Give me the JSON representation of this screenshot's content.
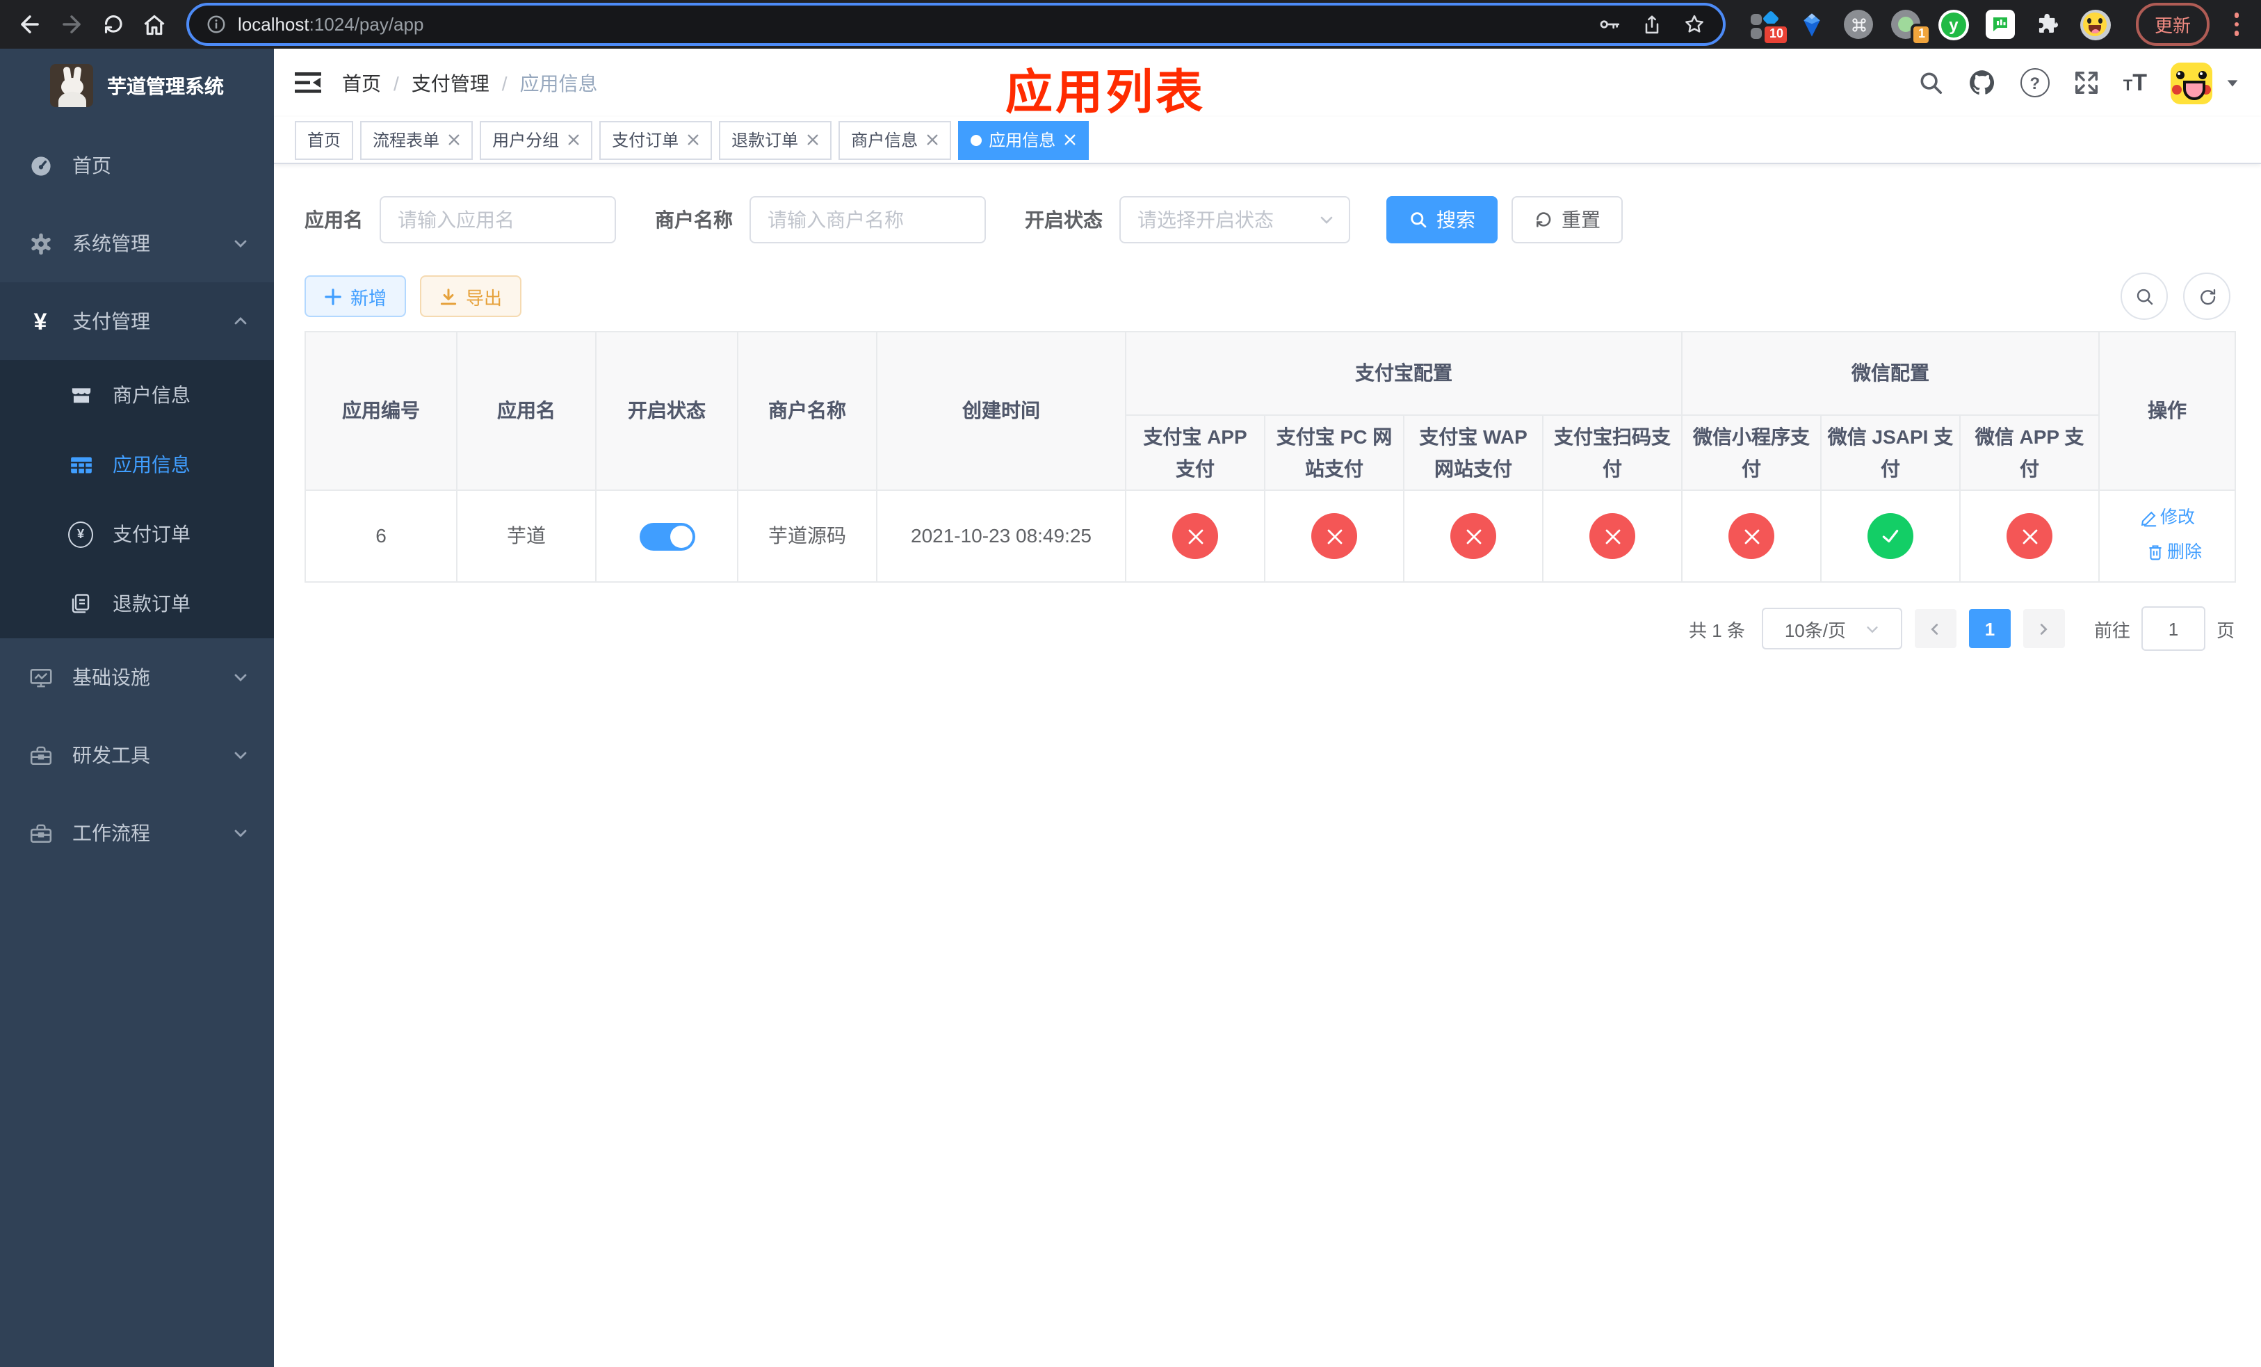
{
  "browser": {
    "url": {
      "host": "localhost",
      "rest": ":1024/pay/app"
    },
    "update_button": "更新",
    "ext_badge_grid": "10",
    "ext_badge_circle": "1",
    "ext_letter": "y"
  },
  "icons": {
    "question": "?",
    "font_small": "T",
    "font_large": "T",
    "yen": "¥"
  },
  "sidebar": {
    "title": "芋道管理系统",
    "menu": [
      {
        "label": "首页"
      },
      {
        "label": "系统管理"
      },
      {
        "label": "支付管理"
      },
      {
        "label": "商户信息"
      },
      {
        "label": "应用信息"
      },
      {
        "label": "支付订单"
      },
      {
        "label": "退款订单"
      },
      {
        "label": "基础设施"
      },
      {
        "label": "研发工具"
      },
      {
        "label": "工作流程"
      }
    ]
  },
  "navbar": {
    "breadcrumb": [
      "首页",
      "支付管理",
      "应用信息"
    ],
    "separator": "/",
    "annotation": "应用列表"
  },
  "tabs": [
    {
      "label": "首页"
    },
    {
      "label": "流程表单"
    },
    {
      "label": "用户分组"
    },
    {
      "label": "支付订单"
    },
    {
      "label": "退款订单"
    },
    {
      "label": "商户信息"
    },
    {
      "label": "应用信息"
    }
  ],
  "filters": {
    "app_name": {
      "label": "应用名",
      "placeholder": "请输入应用名"
    },
    "merchant_name": {
      "label": "商户名称",
      "placeholder": "请输入商户名称"
    },
    "status": {
      "label": "开启状态",
      "placeholder": "请选择开启状态"
    },
    "search": "搜索",
    "reset": "重置"
  },
  "toolbar": {
    "add": "新增",
    "export": "导出"
  },
  "table": {
    "headers": {
      "id": "应用编号",
      "name": "应用名",
      "status": "开启状态",
      "merchant": "商户名称",
      "created": "创建时间",
      "alipay_group": "支付宝配置",
      "wechat_group": "微信配置",
      "actions": "操作"
    },
    "sub_headers": [
      "支付宝 APP 支付",
      "支付宝 PC 网站支付",
      "支付宝 WAP 网站支付",
      "支付宝扫码支付",
      "微信小程序支付",
      "微信 JSAPI 支付",
      "微信 APP 支付"
    ],
    "row": {
      "id": "6",
      "name": "芋道",
      "enabled": true,
      "merchant": "芋道源码",
      "created": "2021-10-23 08:49:25",
      "channels": [
        "no",
        "no",
        "no",
        "no",
        "no",
        "yes",
        "no"
      ],
      "edit": "修改",
      "delete": "删除"
    }
  },
  "pagination": {
    "total": "共 1 条",
    "page_size": "10条/页",
    "page": "1",
    "goto": "前往",
    "goto_value": "1",
    "unit": "页"
  },
  "colors": {
    "primary": "#409eff",
    "success": "#13ce66",
    "danger": "#f45656",
    "warning": "#e6a23c",
    "sidebar_bg": "#304156",
    "submenu_bg": "#1f2d3d",
    "annotation": "#ff2b00"
  }
}
